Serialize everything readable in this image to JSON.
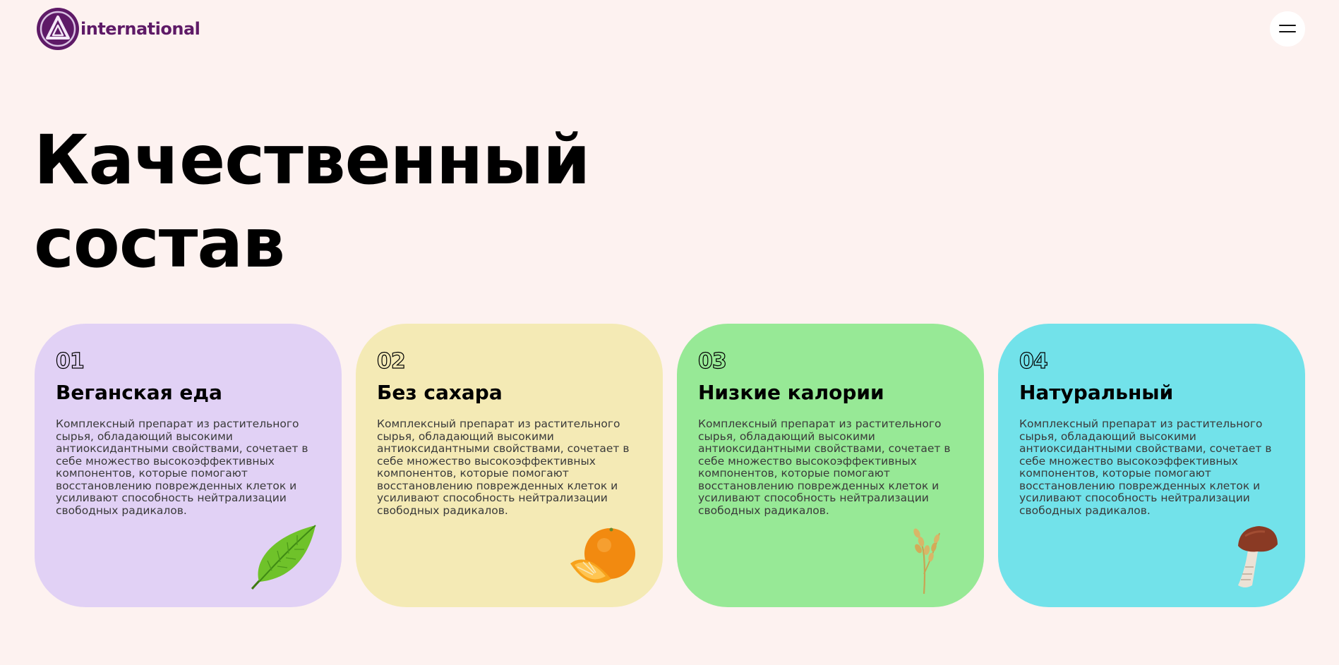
{
  "header": {
    "logo_text": "international",
    "logo_icon": "logo-mark-icon",
    "menu_icon": "hamburger-menu-icon"
  },
  "hero": {
    "title_line1": "Качественный",
    "title_line2": "состав"
  },
  "cards": [
    {
      "number": "01",
      "title": "Веганская еда",
      "description": "Комплексный препарат из растительного сырья, обладающий высокими антиоксидантными свойствами, сочетает в себе множество высокоэффективных компонентов, которые помогают восстановлению поврежденных клеток и усиливают способность нейтрализации свободных радикалов.",
      "icon": "leaf-icon",
      "color": "#e1d1f5"
    },
    {
      "number": "02",
      "title": "Без сахара",
      "description": "Комплексный препарат из растительного сырья, обладающий высокими антиоксидантными свойствами, сочетает в себе множество высокоэффективных компонентов, которые помогают восстановлению поврежденных клеток и усиливают способность нейтрализации свободных радикалов.",
      "icon": "orange-icon",
      "color": "#f4eab5"
    },
    {
      "number": "03",
      "title": "Низкие калории",
      "description": "Комплексный препарат из растительного сырья, обладающий высокими антиоксидантными свойствами, сочетает в себе множество высокоэффективных компонентов, которые помогают восстановлению поврежденных клеток и усиливают способность нейтрализации свободных радикалов.",
      "icon": "wheat-icon",
      "color": "#97e996"
    },
    {
      "number": "04",
      "title": "Натуральный",
      "description": "Комплексный препарат из растительного сырья, обладающий высокими антиоксидантными свойствами, сочетает в себе множество высокоэффективных компонентов, которые помогают восстановлению поврежденных клеток и усиливают способность нейтрализации свободных радикалов.",
      "icon": "mushroom-icon",
      "color": "#72e2ea"
    }
  ],
  "colors": {
    "background": "#fdf2f0",
    "brand_purple": "#5e1a67"
  }
}
